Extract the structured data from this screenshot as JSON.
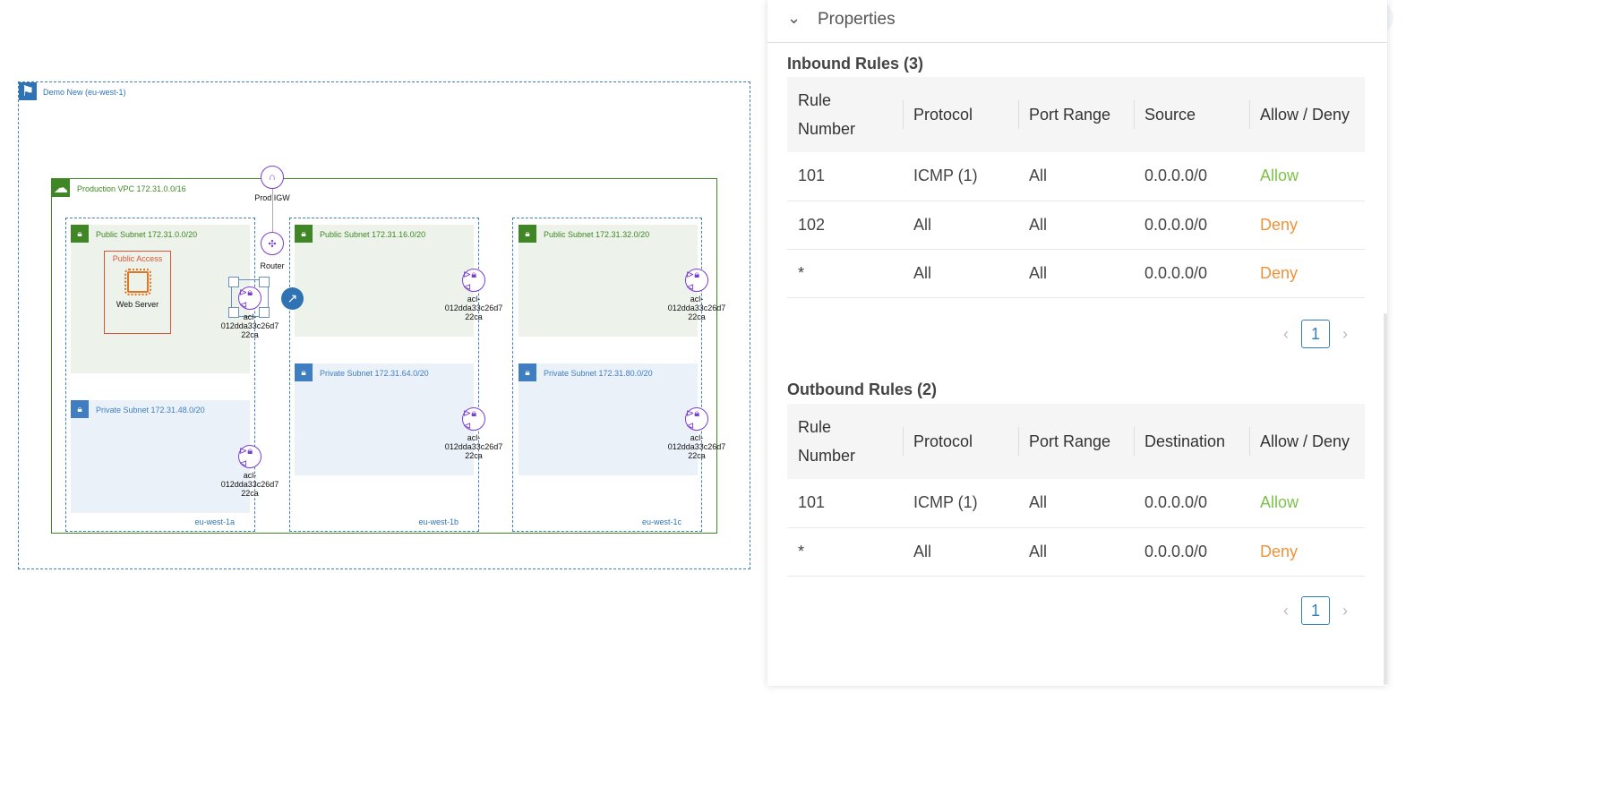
{
  "diagram": {
    "region": "Demo New (eu-west-1)",
    "vpc": "Production VPC 172.31.0.0/16",
    "igw": "Prod IGW",
    "router": "Router",
    "group": "Public Access",
    "instance": "Web Server",
    "acl_label": "acl-012dda33c26d722ca",
    "azs": [
      {
        "name": "eu-west-1a",
        "public": "Public Subnet 172.31.0.0/20",
        "private": "Private Subnet 172.31.48.0/20"
      },
      {
        "name": "eu-west-1b",
        "public": "Public Subnet 172.31.16.0/20",
        "private": "Private Subnet 172.31.64.0/20"
      },
      {
        "name": "eu-west-1c",
        "public": "Public Subnet 172.31.32.0/20",
        "private": "Private Subnet 172.31.80.0/20"
      }
    ]
  },
  "panel": {
    "title": "Properties",
    "inbound": {
      "title": "Inbound Rules (3)",
      "headers": [
        "Rule Number",
        "Protocol",
        "Port Range",
        "Source",
        "Allow / Deny"
      ],
      "rows": [
        [
          "101",
          "ICMP (1)",
          "All",
          "0.0.0.0/0",
          "Allow"
        ],
        [
          "102",
          "All",
          "All",
          "0.0.0.0/0",
          "Deny"
        ],
        [
          "*",
          "All",
          "All",
          "0.0.0.0/0",
          "Deny"
        ]
      ],
      "page": "1"
    },
    "outbound": {
      "title": "Outbound Rules (2)",
      "headers": [
        "Rule Number",
        "Protocol",
        "Port Range",
        "Destination",
        "Allow / Deny"
      ],
      "rows": [
        [
          "101",
          "ICMP (1)",
          "All",
          "0.0.0.0/0",
          "Allow"
        ],
        [
          "*",
          "All",
          "All",
          "0.0.0.0/0",
          "Deny"
        ]
      ],
      "page": "1"
    }
  },
  "colors": {
    "allow": "#7dc24b",
    "deny": "#f0923a",
    "vpc": "#3f8624",
    "private": "#3f7fc1",
    "acl": "#7a3fd1"
  }
}
